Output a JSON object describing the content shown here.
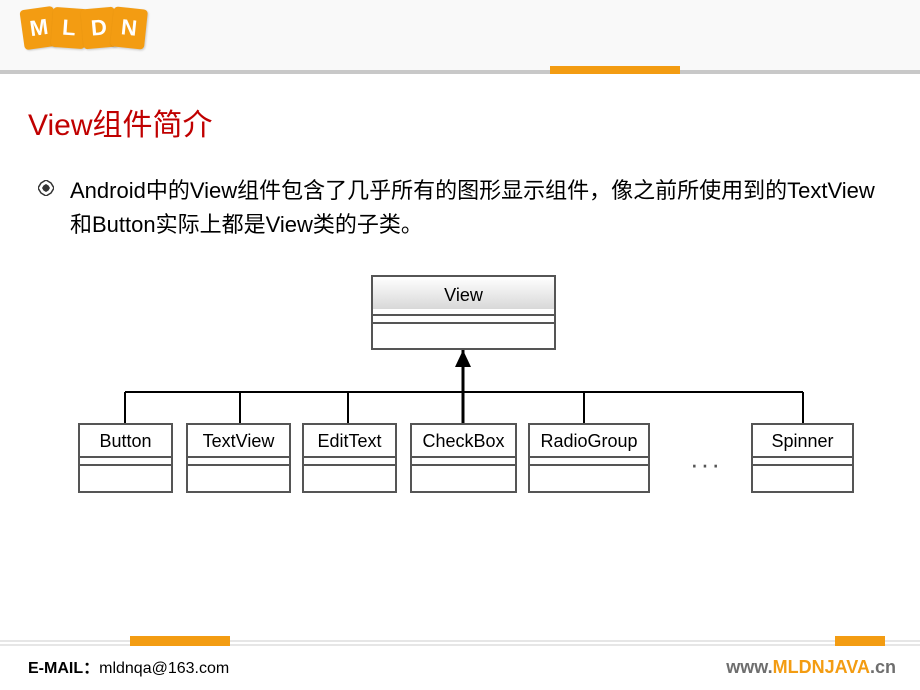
{
  "logo": {
    "letters": [
      "M",
      "L",
      "D",
      "N"
    ]
  },
  "title": "View组件简介",
  "body_text": "Android中的View组件包含了几乎所有的图形显示组件，像之前所使用到的TextView和Button实际上都是View类的子类。",
  "diagram": {
    "parent": "View",
    "children": [
      "Button",
      "TextView",
      "EditText",
      "CheckBox",
      "RadioGroup",
      "Spinner"
    ],
    "ellipsis": "···"
  },
  "footer": {
    "email_label": "E-MAIL：",
    "email_value": "mldnqa@163.com",
    "site_prefix": "www.",
    "site_name": "MLDNJAVA",
    "site_suffix": ".cn"
  }
}
